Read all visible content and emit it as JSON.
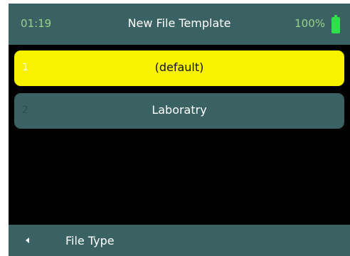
{
  "status_bar": {
    "time": "01:19",
    "title": "New File Template",
    "battery_percent": "100%",
    "battery_icon": "battery-full-icon"
  },
  "menu": {
    "items": [
      {
        "index": "1",
        "label": "(default)",
        "selected": true
      },
      {
        "index": "2",
        "label": "Laboratry",
        "selected": false
      }
    ]
  },
  "bottom_bar": {
    "back_icon": "triangle-left-icon",
    "label": "File Type"
  },
  "colors": {
    "bar": "#3a6262",
    "selected": "#f8f200",
    "time_text": "#9ad08c",
    "battery": "#2ee04a"
  }
}
